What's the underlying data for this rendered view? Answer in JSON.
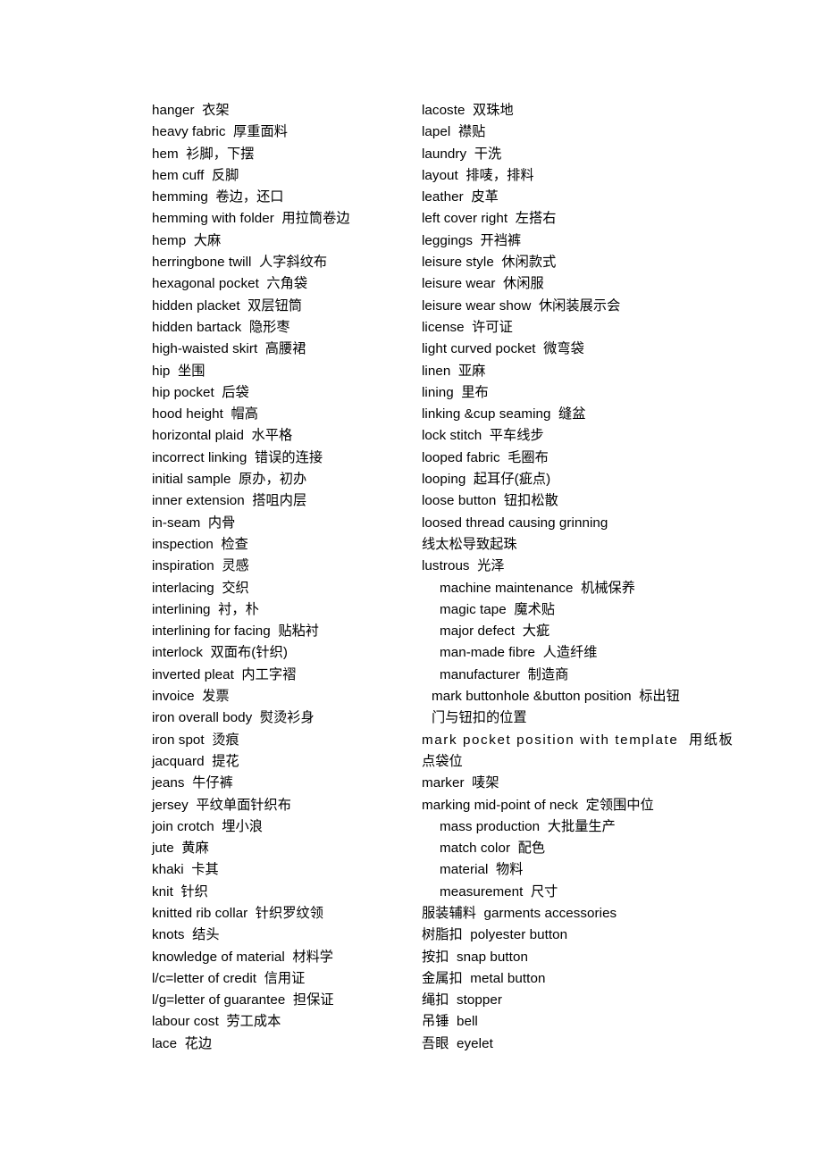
{
  "document": {
    "type": "glossary",
    "title_visible": false,
    "page_background": "#ffffff",
    "text_color": "#000000",
    "columns": 2,
    "left_column": {
      "name": "glossary-column-left",
      "entries": [
        {
          "text": "hanger  衣架",
          "indent": "none"
        },
        {
          "text": "heavy fabric  厚重面料",
          "indent": "none"
        },
        {
          "text": "hem  衫脚，下摆",
          "indent": "none"
        },
        {
          "text": "hem cuff  反脚",
          "indent": "none"
        },
        {
          "text": "hemming  卷边，还口",
          "indent": "none"
        },
        {
          "text": "hemming with folder  用拉筒卷边",
          "indent": "none"
        },
        {
          "text": "hemp  大麻",
          "indent": "none"
        },
        {
          "text": "herringbone twill  人字斜纹布",
          "indent": "none"
        },
        {
          "text": "hexagonal pocket  六角袋",
          "indent": "none"
        },
        {
          "text": "hidden placket  双层钮筒",
          "indent": "none"
        },
        {
          "text": "hidden bartack  隐形枣",
          "indent": "none"
        },
        {
          "text": "high-waisted skirt  高腰裙",
          "indent": "none"
        },
        {
          "text": "hip  坐围",
          "indent": "none"
        },
        {
          "text": "hip pocket  后袋",
          "indent": "none"
        },
        {
          "text": "hood height  帽高",
          "indent": "none"
        },
        {
          "text": "horizontal plaid  水平格",
          "indent": "none"
        },
        {
          "text": "incorrect linking  错误的连接",
          "indent": "none"
        },
        {
          "text": "initial sample  原办，初办",
          "indent": "none"
        },
        {
          "text": "inner extension  搭咀内层",
          "indent": "none"
        },
        {
          "text": "in-seam  内骨",
          "indent": "none"
        },
        {
          "text": "inspection  检查",
          "indent": "none"
        },
        {
          "text": "inspiration  灵感",
          "indent": "none"
        },
        {
          "text": "interlacing  交织",
          "indent": "none"
        },
        {
          "text": "interlining  衬，朴",
          "indent": "none"
        },
        {
          "text": "interlining for facing  贴粘衬",
          "indent": "none"
        },
        {
          "text": "interlock  双面布(针织)",
          "indent": "none"
        },
        {
          "text": "inverted pleat  内工字褶",
          "indent": "none"
        },
        {
          "text": "invoice  发票",
          "indent": "none"
        },
        {
          "text": "iron overall body  熨烫衫身",
          "indent": "none"
        },
        {
          "text": "iron spot  烫痕",
          "indent": "none"
        },
        {
          "text": "jacquard  提花",
          "indent": "none"
        },
        {
          "text": "jeans  牛仔裤",
          "indent": "none"
        },
        {
          "text": "jersey  平纹单面针织布",
          "indent": "none"
        },
        {
          "text": "join crotch  埋小浪",
          "indent": "none"
        },
        {
          "text": "jute  黄麻",
          "indent": "none"
        },
        {
          "text": "khaki  卡其",
          "indent": "none"
        },
        {
          "text": "knit  针织",
          "indent": "none"
        },
        {
          "text": "knitted rib collar  针织罗纹领",
          "indent": "none"
        },
        {
          "text": "knots  结头",
          "indent": "none"
        },
        {
          "text": "knowledge of material  材料学",
          "indent": "none"
        },
        {
          "text": "l/c=letter of credit  信用证",
          "indent": "none"
        },
        {
          "text": "l/g=letter of guarantee  担保证",
          "indent": "none"
        },
        {
          "text": "labour cost  劳工成本",
          "indent": "none"
        },
        {
          "text": "lace  花边",
          "indent": "none"
        }
      ]
    },
    "right_column": {
      "name": "glossary-column-right",
      "entries": [
        {
          "text": "lacoste  双珠地",
          "indent": "small"
        },
        {
          "text": "lapel  襟贴",
          "indent": "small"
        },
        {
          "text": "laundry  干洗",
          "indent": "small"
        },
        {
          "text": "layout  排唛，排料",
          "indent": "small"
        },
        {
          "text": "leather  皮革",
          "indent": "small"
        },
        {
          "text": "left cover right  左搭右",
          "indent": "small"
        },
        {
          "text": "leggings  开裆裤",
          "indent": "small"
        },
        {
          "text": "leisure style  休闲款式",
          "indent": "small"
        },
        {
          "text": "leisure wear  休闲服",
          "indent": "small"
        },
        {
          "text": "leisure wear show  休闲装展示会",
          "indent": "small"
        },
        {
          "text": "license  许可证",
          "indent": "small"
        },
        {
          "text": "light curved pocket  微弯袋",
          "indent": "small"
        },
        {
          "text": "linen  亚麻",
          "indent": "small"
        },
        {
          "text": "lining  里布",
          "indent": "small"
        },
        {
          "text": "linking &cup seaming  缝盆",
          "indent": "small"
        },
        {
          "text": "lock stitch  平车线步",
          "indent": "small"
        },
        {
          "text": "looped fabric  毛圈布",
          "indent": "small"
        },
        {
          "text": "looping  起耳仔(疵点)",
          "indent": "small"
        },
        {
          "text": "loose button  钮扣松散",
          "indent": "small"
        },
        {
          "text": "loosed thread causing grinning",
          "indent": "small",
          "wrapped": true,
          "line2": "线太松导致起珠",
          "line2_indent": "small"
        },
        {
          "text": "lustrous  光泽",
          "indent": "small"
        },
        {
          "text": "machine maintenance  机械保养",
          "indent": "medium"
        },
        {
          "text": "magic tape  魔术贴",
          "indent": "medium"
        },
        {
          "text": "major defect  大疵",
          "indent": "medium"
        },
        {
          "text": "man-made fibre  人造纤维",
          "indent": "medium"
        },
        {
          "text": "manufacturer  制造商",
          "indent": "medium"
        },
        {
          "text": "mark buttonhole &button position  标出钮",
          "indent": "tiny",
          "wrapped": true,
          "line2": "门与钮扣的位置",
          "line2_indent": "none"
        },
        {
          "text": "mark pocket position with template  用纸板",
          "indent": "none",
          "justified": true,
          "wrapped": true,
          "line2": "点袋位",
          "line2_indent": "none"
        },
        {
          "text": "marker  唛架",
          "indent": "none"
        },
        {
          "text": "marking mid-point of neck  定领围中位",
          "indent": "none"
        },
        {
          "text": "mass production  大批量生产",
          "indent": "medium"
        },
        {
          "text": "match color  配色",
          "indent": "medium"
        },
        {
          "text": "material  物料",
          "indent": "medium"
        },
        {
          "text": "measurement  尺寸",
          "indent": "medium"
        },
        {
          "text": "服装辅料  garments accessories",
          "indent": "none"
        },
        {
          "text": "树脂扣  polyester button",
          "indent": "none"
        },
        {
          "text": "按扣  snap button",
          "indent": "none"
        },
        {
          "text": "金属扣  metal button",
          "indent": "none"
        },
        {
          "text": "绳扣  stopper",
          "indent": "none"
        },
        {
          "text": "吊锤  bell",
          "indent": "none"
        },
        {
          "text": "吾眼  eyelet",
          "indent": "none"
        }
      ]
    }
  }
}
